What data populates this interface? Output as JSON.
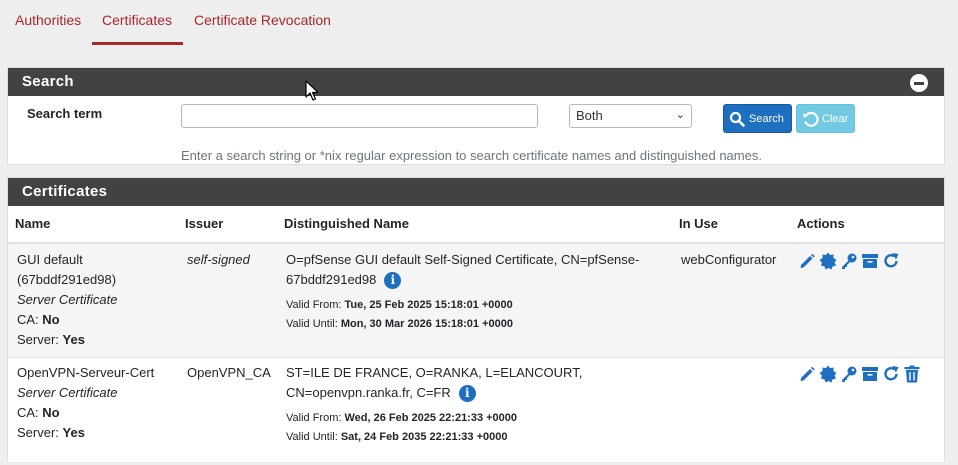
{
  "tabs": [
    {
      "label": "Authorities"
    },
    {
      "label": "Certificates"
    },
    {
      "label": "Certificate Revocation"
    }
  ],
  "search": {
    "title": "Search",
    "term_label": "Search term",
    "value": "",
    "placeholder": "",
    "scope_selected": "Both",
    "search_button": "Search",
    "clear_button": "Clear",
    "help": "Enter a search string or *nix regular expression to search certificate names and distinguished names."
  },
  "certificates": {
    "title": "Certificates",
    "columns": [
      "Name",
      "Issuer",
      "Distinguished Name",
      "In Use",
      "Actions"
    ],
    "rows": [
      {
        "name": "GUI default",
        "name_id": "(67bddf291ed98)",
        "type": "Server Certificate",
        "ca_label": "CA:",
        "ca": "No",
        "server_label": "Server:",
        "server": "Yes",
        "issuer": "self-signed",
        "dn_line1": "O=pfSense GUI default Self-Signed Certificate, CN=pfSense-",
        "dn_line2": "67bddf291ed98",
        "valid_from_label": "Valid From:",
        "valid_from": "Tue, 25 Feb 2025 15:18:01 +0000",
        "valid_until_label": "Valid Until:",
        "valid_until": "Mon, 30 Mar 2026 15:18:01 +0000",
        "in_use": "webConfigurator"
      },
      {
        "name": "OpenVPN-Serveur-Cert",
        "type": "Server Certificate",
        "ca_label": "CA:",
        "ca": "No",
        "server_label": "Server:",
        "server": "Yes",
        "issuer": "OpenVPN_CA",
        "dn_line1": "ST=ILE DE FRANCE, O=RANKA, L=ELANCOURT,",
        "dn_line2": "CN=openvpn.ranka.fr, C=FR",
        "valid_from_label": "Valid From:",
        "valid_from": "Wed, 26 Feb 2025 22:21:33 +0000",
        "valid_until_label": "Valid Until:",
        "valid_until": "Sat, 24 Feb 2035 22:21:33 +0000",
        "in_use": ""
      }
    ]
  },
  "colors": {
    "accent": "#a8282a",
    "panel_header": "#424242",
    "primary": "#1e6fc0",
    "info": "#5bc0de"
  },
  "icons": [
    "pencil-icon",
    "certificate-icon",
    "key-icon",
    "archive-icon",
    "renew-icon",
    "trash-icon",
    "info-icon",
    "search-icon",
    "undo-icon",
    "minus-circle-icon"
  ]
}
